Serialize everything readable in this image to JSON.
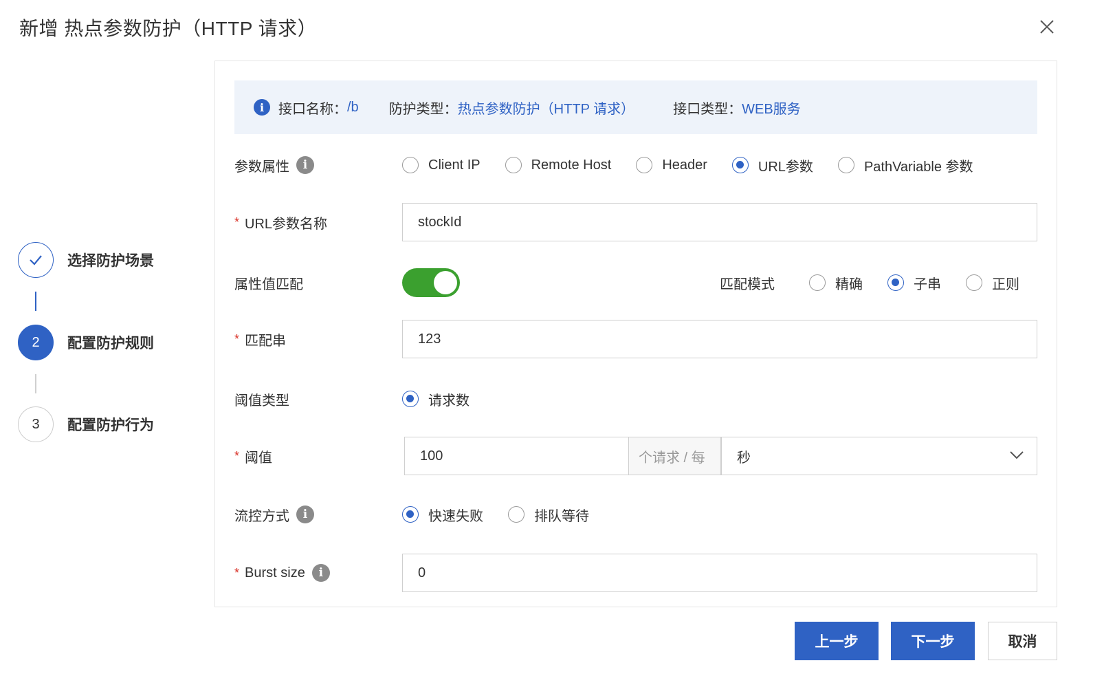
{
  "dialog": {
    "title": "新增 热点参数防护（HTTP 请求）"
  },
  "steps": [
    {
      "label": "选择防护场景",
      "status": "done",
      "marker": ""
    },
    {
      "label": "配置防护规则",
      "status": "active",
      "marker": "2"
    },
    {
      "label": "配置防护行为",
      "status": "todo",
      "marker": "3"
    }
  ],
  "info": {
    "api_name_label": "接口名称：",
    "api_name_value": "/b",
    "protect_type_label": "防护类型：",
    "protect_type_value": "热点参数防护（HTTP 请求）",
    "api_type_label": "接口类型：",
    "api_type_value": "WEB服务"
  },
  "form": {
    "param_attr": {
      "label": "参数属性",
      "options": [
        "Client IP",
        "Remote Host",
        "Header",
        "URL参数",
        "PathVariable 参数"
      ],
      "selected": "URL参数"
    },
    "url_param_name": {
      "label": "URL参数名称",
      "value": "stockId"
    },
    "attr_match": {
      "label": "属性值匹配",
      "enabled": true,
      "mode_label": "匹配模式",
      "mode_options": [
        "精确",
        "子串",
        "正则"
      ],
      "mode_selected": "子串"
    },
    "match_string": {
      "label": "匹配串",
      "value": "123"
    },
    "threshold_type": {
      "label": "阈值类型",
      "options": [
        "请求数"
      ],
      "selected": "请求数"
    },
    "threshold": {
      "label": "阈值",
      "value": "100",
      "addon": "个请求 / 每",
      "unit": "秒"
    },
    "flow_control": {
      "label": "流控方式",
      "options": [
        "快速失败",
        "排队等待"
      ],
      "selected": "快速失败"
    },
    "burst_size": {
      "label": "Burst size",
      "value": "0"
    }
  },
  "buttons": {
    "prev": "上一步",
    "next": "下一步",
    "cancel": "取消"
  },
  "colors": {
    "primary": "#2f62c4",
    "toggle_on": "#3ba02f",
    "required": "#d93026",
    "info_bg": "#eef3fa"
  }
}
